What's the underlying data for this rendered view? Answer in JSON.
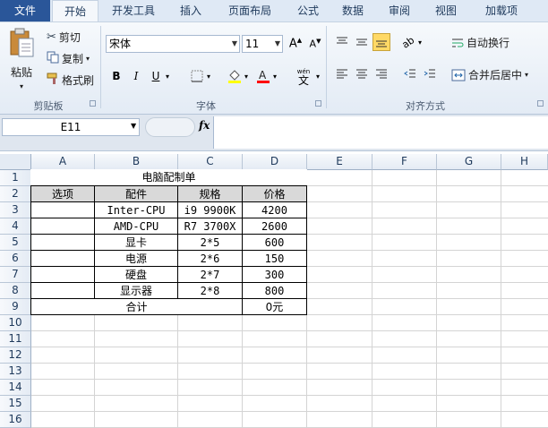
{
  "tabs": [
    "文件",
    "开始",
    "开发工具",
    "插入",
    "页面布局",
    "公式",
    "数据",
    "审阅",
    "视图",
    "加载项"
  ],
  "clipboard": {
    "paste_label": "粘贴",
    "cut_label": "剪切",
    "copy_label": "复制",
    "format_painter_label": "格式刷",
    "group_label": "剪贴板"
  },
  "font": {
    "font_name": "宋体",
    "font_size": "11",
    "bold": "B",
    "italic": "I",
    "underline": "U",
    "phonetic": "wén",
    "group_label": "字体"
  },
  "alignment": {
    "wrap_text_label": "自动换行",
    "merge_center_label": "合并后居中",
    "group_label": "对齐方式"
  },
  "formula_bar": {
    "name_box": "E11",
    "fx": "fx",
    "formula": ""
  },
  "sheet": {
    "columns": [
      "A",
      "B",
      "C",
      "D",
      "E",
      "F",
      "G",
      "H"
    ],
    "rows": [
      "1",
      "2",
      "3",
      "4",
      "5",
      "6",
      "7",
      "8",
      "9",
      "10",
      "11",
      "12",
      "13",
      "14",
      "15",
      "16"
    ],
    "title": "电脑配制单",
    "headers": [
      "选项",
      "配件",
      "规格",
      "价格"
    ],
    "items": [
      {
        "part": "Inter-CPU",
        "spec": "i9 9900K",
        "price": "4200"
      },
      {
        "part": "AMD-CPU",
        "spec": "R7 3700X",
        "price": "2600"
      },
      {
        "part": "显卡",
        "spec": "2*5",
        "price": "600"
      },
      {
        "part": "电源",
        "spec": "2*6",
        "price": "150"
      },
      {
        "part": "硬盘",
        "spec": "2*7",
        "price": "300"
      },
      {
        "part": "显示器",
        "spec": "2*8",
        "price": "800"
      }
    ],
    "total_label": "合计",
    "total_value": "0元"
  },
  "colors": {
    "file_tab": "#2a5699",
    "header_fill": "#d9d9d9",
    "highlight": "#ffd966",
    "font_color_bar": "#ff0000"
  }
}
